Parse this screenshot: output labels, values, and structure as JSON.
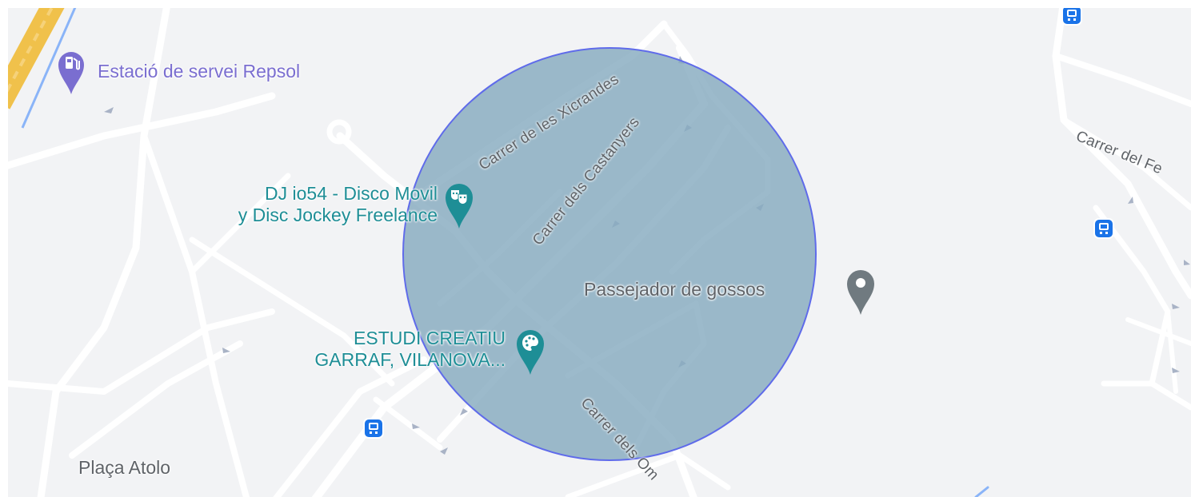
{
  "colors": {
    "background": "#f2f3f5",
    "road": "#ffffff",
    "highway": "#f6c443",
    "circle_fill": "#86abc0",
    "circle_stroke": "#5f6bea",
    "poi_purple": "#7a6ed0",
    "poi_teal": "#1e8e96",
    "poi_gray": "#707a80",
    "bus_stop": "#1a73e8"
  },
  "pois": {
    "gas_station": {
      "label": "Estació de servei Repsol",
      "icon": "gas-station-icon"
    },
    "dj": {
      "line1": "DJ io54 - Disco Movil",
      "line2": "y Disc Jockey Freelance",
      "icon": "theater-masks-icon"
    },
    "studio": {
      "line1": "ESTUDI CREATIU",
      "line2": "GARRAF, VILANOVA...",
      "icon": "palette-icon"
    },
    "dog_walker": {
      "label": "Passejador de gossos",
      "icon": "map-pin-icon"
    },
    "square": {
      "label": "Plaça Atolo"
    }
  },
  "streets": {
    "xicrandes": "Carrer de les Xicrandes",
    "castanyers": "Carrer dels Castanyers",
    "oms": "Carrer dels Om",
    "fe": "Carrer del Fe"
  },
  "bus_stops": [
    {
      "icon": "bus-stop-icon"
    },
    {
      "icon": "bus-stop-icon"
    },
    {
      "icon": "bus-stop-icon"
    }
  ]
}
